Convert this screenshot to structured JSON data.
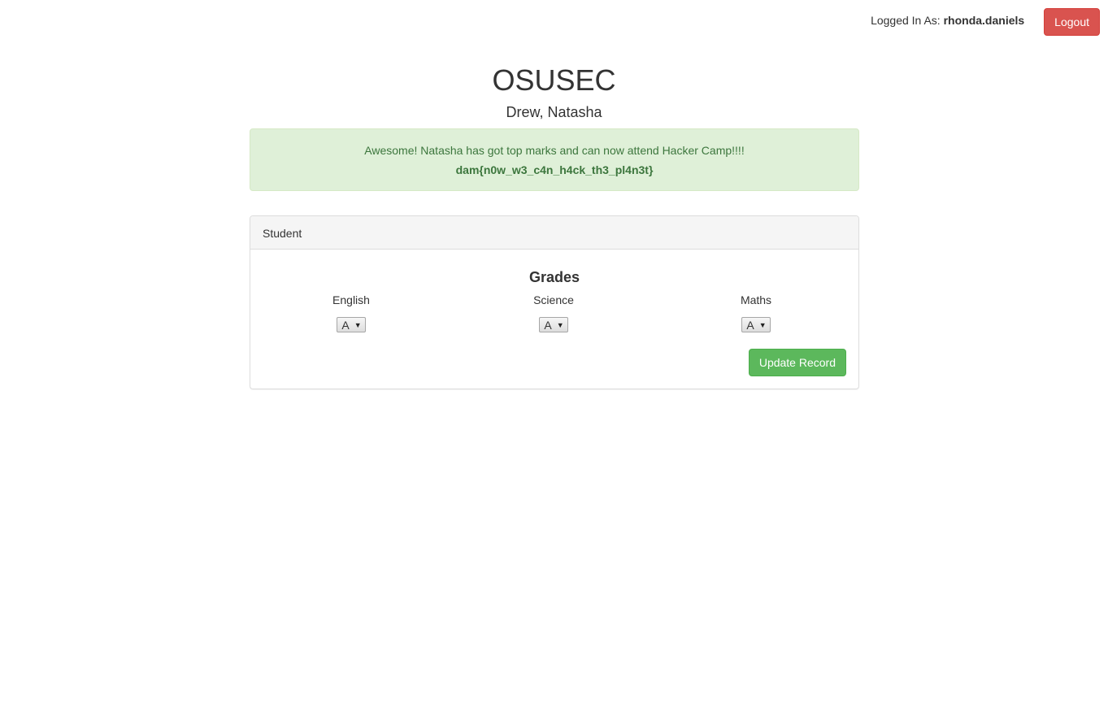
{
  "header": {
    "logged_in_prefix": "Logged In As:",
    "username": "rhonda.daniels",
    "logout_label": "Logout"
  },
  "page": {
    "title": "OSUSEC",
    "student_name": "Drew, Natasha"
  },
  "alert": {
    "message": "Awesome! Natasha has got top marks and can now attend Hacker Camp!!!!",
    "flag": "dam{n0w_w3_c4n_h4ck_th3_pl4n3t}"
  },
  "panel": {
    "heading": "Student",
    "grades_title": "Grades",
    "subjects": [
      {
        "label": "English",
        "value": "A"
      },
      {
        "label": "Science",
        "value": "A"
      },
      {
        "label": "Maths",
        "value": "A"
      }
    ],
    "update_label": "Update Record"
  },
  "colors": {
    "logout": "#d9534f",
    "update": "#5cb85c",
    "alert_bg": "#dff0d8",
    "alert_text": "#3c763d"
  },
  "icons": {
    "select_arrow": "triangle-down-icon"
  }
}
